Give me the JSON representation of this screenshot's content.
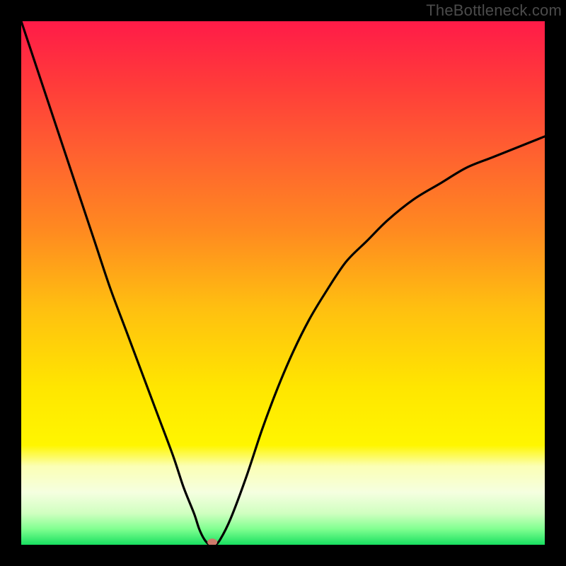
{
  "watermark": "TheBottleneck.com",
  "chart_data": {
    "type": "line",
    "title": "",
    "xlabel": "",
    "ylabel": "",
    "xlim": [
      0,
      100
    ],
    "ylim": [
      0,
      100
    ],
    "x": [
      0,
      2,
      5,
      8,
      11,
      14,
      17,
      20,
      23,
      26,
      29,
      31,
      33,
      34,
      35,
      36,
      37,
      38,
      40,
      43,
      46,
      49,
      52,
      55,
      58,
      62,
      66,
      70,
      75,
      80,
      85,
      90,
      95,
      100
    ],
    "values": [
      100,
      94,
      85,
      76,
      67,
      58,
      49,
      41,
      33,
      25,
      17,
      11,
      6,
      3,
      1,
      0,
      0,
      1,
      5,
      13,
      22,
      30,
      37,
      43,
      48,
      54,
      58,
      62,
      66,
      69,
      72,
      74,
      76,
      78
    ],
    "marker": {
      "x": 36.5,
      "y": 0.5,
      "color": "#cd7a6b"
    },
    "gradient": {
      "stops": [
        {
          "pos": 0.0,
          "color": "#ff1b48"
        },
        {
          "pos": 0.12,
          "color": "#ff3b3a"
        },
        {
          "pos": 0.25,
          "color": "#ff6030"
        },
        {
          "pos": 0.4,
          "color": "#ff8a20"
        },
        {
          "pos": 0.55,
          "color": "#ffc010"
        },
        {
          "pos": 0.7,
          "color": "#ffe600"
        },
        {
          "pos": 0.81,
          "color": "#fff600"
        },
        {
          "pos": 0.85,
          "color": "#fbffb5"
        },
        {
          "pos": 0.9,
          "color": "#f5ffe0"
        },
        {
          "pos": 0.94,
          "color": "#d0ffc0"
        },
        {
          "pos": 0.97,
          "color": "#80ff90"
        },
        {
          "pos": 1.0,
          "color": "#18e060"
        }
      ]
    },
    "grid": false,
    "legend": false
  }
}
